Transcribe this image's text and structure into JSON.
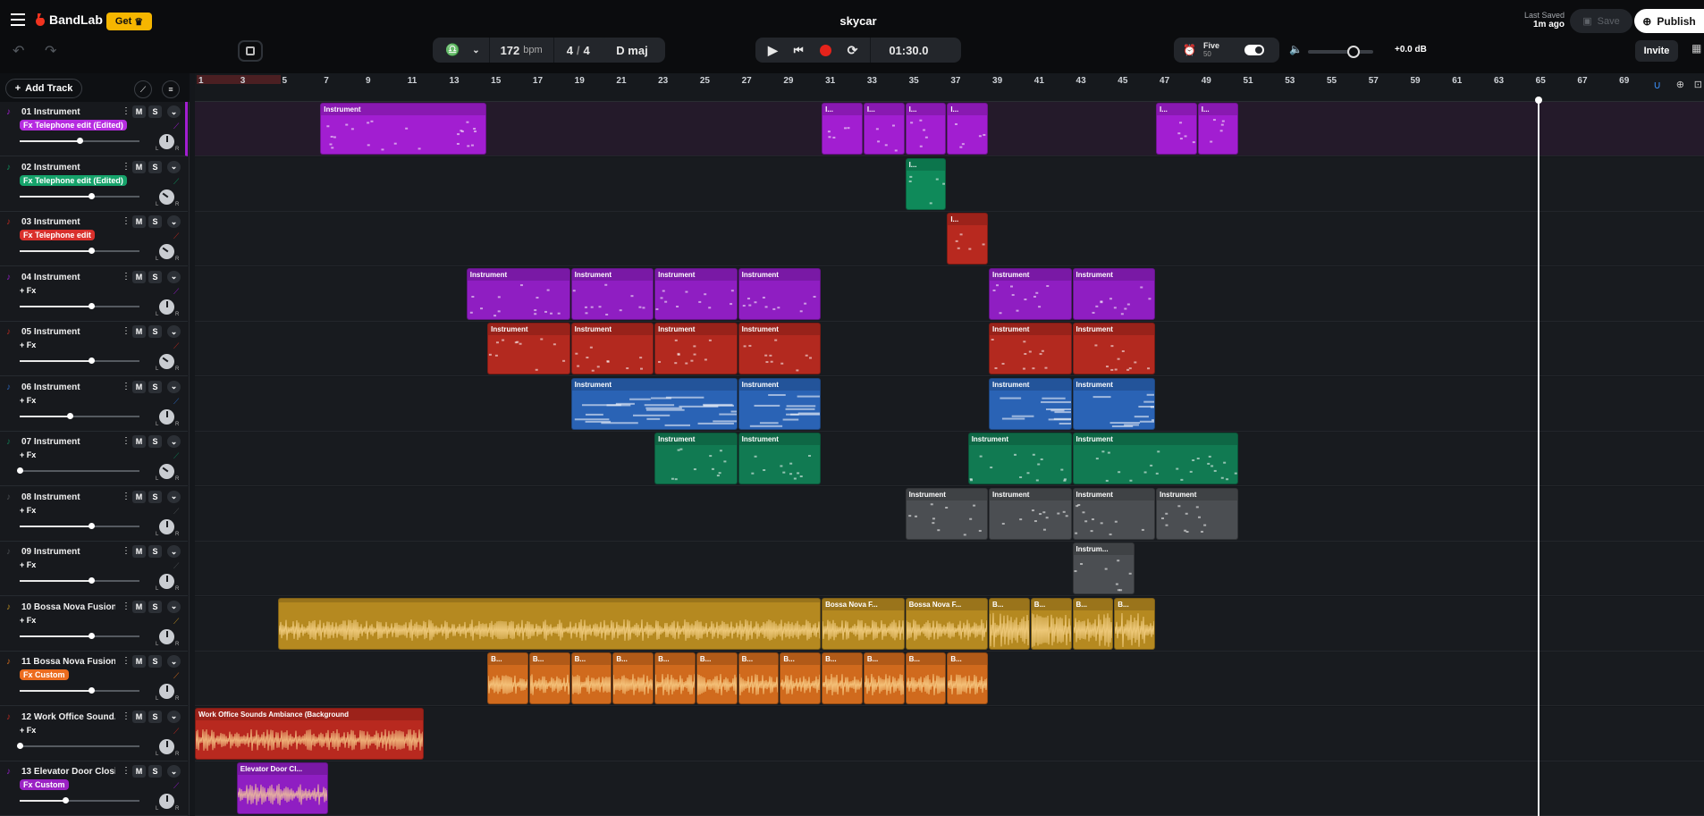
{
  "app": {
    "brand": "BandLab",
    "get_label": "Get",
    "project": "skycar",
    "last_saved_label": "Last Saved",
    "last_saved_time": "1m ago",
    "save_label": "Save",
    "publish_label": "Publish",
    "invite_label": "Invite"
  },
  "transport": {
    "bpm": "172",
    "bpm_unit": "bpm",
    "sig_num": "4",
    "sig_den": "4",
    "key": "D maj",
    "time": "01:30.0",
    "metronome_name": "Five",
    "metronome_count": "50",
    "master_db": "+0.0 dB"
  },
  "header": {
    "add_track": "Add Track"
  },
  "ruler": [
    "1",
    "3",
    "5",
    "7",
    "9",
    "11",
    "13",
    "15",
    "17",
    "19",
    "21",
    "23",
    "25",
    "27",
    "29",
    "31",
    "33",
    "35",
    "37",
    "39",
    "41",
    "43",
    "45",
    "47",
    "49",
    "51",
    "53",
    "55",
    "57",
    "59",
    "61",
    "63",
    "65",
    "67",
    "69"
  ],
  "common": {
    "mute": "M",
    "solo": "S",
    "fx_add": "+ Fx",
    "pan_l": "L",
    "pan_r": "R"
  },
  "tracks": [
    {
      "num": "01",
      "name": "Instrument",
      "fx": "Fx Telephone edit (Edited)",
      "fx_color": "#b62ce0",
      "color": "#a21ed1",
      "vol": 0.5,
      "pan": 0.5
    },
    {
      "num": "02",
      "name": "Instrument",
      "fx": "Fx Telephone edit (Edited)",
      "fx_color": "#16a36b",
      "color": "#0f8a5a",
      "vol": 0.6,
      "pan": 0.3
    },
    {
      "num": "03",
      "name": "Instrument",
      "fx": "Fx Telephone edit",
      "fx_color": "#d9302c",
      "color": "#b8291f",
      "vol": 0.6,
      "pan": 0.3
    },
    {
      "num": "04",
      "name": "Instrument",
      "fx": "+ Fx",
      "fx_color": "",
      "color": "#8f1ec2",
      "vol": 0.6,
      "pan": 0.5
    },
    {
      "num": "05",
      "name": "Instrument",
      "fx": "+ Fx",
      "fx_color": "",
      "color": "#b3291f",
      "vol": 0.6,
      "pan": 0.3
    },
    {
      "num": "06",
      "name": "Instrument",
      "fx": "+ Fx",
      "fx_color": "",
      "color": "#2a63b5",
      "vol": 0.42,
      "pan": 0.5
    },
    {
      "num": "07",
      "name": "Instrument",
      "fx": "+ Fx",
      "fx_color": "",
      "color": "#117a52",
      "vol": 0.0,
      "pan": 0.3
    },
    {
      "num": "08",
      "name": "Instrument",
      "fx": "+ Fx",
      "fx_color": "",
      "color": "#4b4e52",
      "vol": 0.6,
      "pan": 0.5
    },
    {
      "num": "09",
      "name": "Instrument",
      "fx": "+ Fx",
      "fx_color": "",
      "color": "#4b4e52",
      "vol": 0.6,
      "pan": 0.5
    },
    {
      "num": "10",
      "name": "Bossa Nova Fusion...",
      "fx": "+ Fx",
      "fx_color": "",
      "color": "#b58920",
      "vol": 0.6,
      "pan": 0.5
    },
    {
      "num": "11",
      "name": "Bossa Nova Fusion...",
      "fx": "Fx Custom",
      "fx_color": "#ec6c1e",
      "color": "#d06a1d",
      "vol": 0.6,
      "pan": 0.5
    },
    {
      "num": "12",
      "name": "Work Office Sound...",
      "fx": "+ Fx",
      "fx_color": "",
      "color": "#b8291f",
      "vol": 0.0,
      "pan": 0.5
    },
    {
      "num": "13",
      "name": "Elevator Door Closi...",
      "fx": "Fx Custom",
      "fx_color": "#9b22c4",
      "color": "#8f1ec2",
      "vol": 0.38,
      "pan": 0.5
    }
  ],
  "clips": [
    {
      "track": 0,
      "start": 7,
      "end": 15,
      "label": "Instrument",
      "kind": "midi"
    },
    {
      "track": 0,
      "start": 31,
      "end": 33,
      "label": "I...",
      "kind": "midi"
    },
    {
      "track": 0,
      "start": 33,
      "end": 35,
      "label": "I...",
      "kind": "midi"
    },
    {
      "track": 0,
      "start": 35,
      "end": 37,
      "label": "I...",
      "kind": "midi"
    },
    {
      "track": 0,
      "start": 37,
      "end": 39,
      "label": "I...",
      "kind": "midi"
    },
    {
      "track": 0,
      "start": 47,
      "end": 49,
      "label": "I...",
      "kind": "midi"
    },
    {
      "track": 0,
      "start": 49,
      "end": 51,
      "label": "I...",
      "kind": "midi"
    },
    {
      "track": 1,
      "start": 35,
      "end": 37,
      "label": "I...",
      "kind": "midi"
    },
    {
      "track": 2,
      "start": 37,
      "end": 39,
      "label": "I...",
      "kind": "midi"
    },
    {
      "track": 3,
      "start": 14,
      "end": 19,
      "label": "Instrument",
      "kind": "midi"
    },
    {
      "track": 3,
      "start": 19,
      "end": 23,
      "label": "Instrument",
      "kind": "midi"
    },
    {
      "track": 3,
      "start": 23,
      "end": 27,
      "label": "Instrument",
      "kind": "midi"
    },
    {
      "track": 3,
      "start": 27,
      "end": 31,
      "label": "Instrument",
      "kind": "midi"
    },
    {
      "track": 3,
      "start": 39,
      "end": 43,
      "label": "Instrument",
      "kind": "midi"
    },
    {
      "track": 3,
      "start": 43,
      "end": 47,
      "label": "Instrument",
      "kind": "midi"
    },
    {
      "track": 4,
      "start": 15,
      "end": 19,
      "label": "Instrument",
      "kind": "midi"
    },
    {
      "track": 4,
      "start": 19,
      "end": 23,
      "label": "Instrument",
      "kind": "midi"
    },
    {
      "track": 4,
      "start": 23,
      "end": 27,
      "label": "Instrument",
      "kind": "midi"
    },
    {
      "track": 4,
      "start": 27,
      "end": 31,
      "label": "Instrument",
      "kind": "midi"
    },
    {
      "track": 4,
      "start": 39,
      "end": 43,
      "label": "Instrument",
      "kind": "midi"
    },
    {
      "track": 4,
      "start": 43,
      "end": 47,
      "label": "Instrument",
      "kind": "midi"
    },
    {
      "track": 5,
      "start": 19,
      "end": 27,
      "label": "Instrument",
      "kind": "midi"
    },
    {
      "track": 5,
      "start": 27,
      "end": 31,
      "label": "Instrument",
      "kind": "midi"
    },
    {
      "track": 5,
      "start": 39,
      "end": 43,
      "label": "Instrument",
      "kind": "midi"
    },
    {
      "track": 5,
      "start": 43,
      "end": 47,
      "label": "Instrument",
      "kind": "midi"
    },
    {
      "track": 6,
      "start": 23,
      "end": 27,
      "label": "Instrument",
      "kind": "midi"
    },
    {
      "track": 6,
      "start": 27,
      "end": 31,
      "label": "Instrument",
      "kind": "midi"
    },
    {
      "track": 6,
      "start": 38,
      "end": 43,
      "label": "Instrument",
      "kind": "midi"
    },
    {
      "track": 6,
      "start": 43,
      "end": 51,
      "label": "Instrument",
      "kind": "midi"
    },
    {
      "track": 7,
      "start": 35,
      "end": 39,
      "label": "Instrument",
      "kind": "midi"
    },
    {
      "track": 7,
      "start": 39,
      "end": 43,
      "label": "Instrument",
      "kind": "midi"
    },
    {
      "track": 7,
      "start": 43,
      "end": 47,
      "label": "Instrument",
      "kind": "midi"
    },
    {
      "track": 7,
      "start": 47,
      "end": 51,
      "label": "Instrument",
      "kind": "midi"
    },
    {
      "track": 8,
      "start": 43,
      "end": 46,
      "label": "Instrum...",
      "kind": "midi"
    },
    {
      "track": 9,
      "start": 5,
      "end": 31,
      "label": "",
      "kind": "audio"
    },
    {
      "track": 9,
      "start": 31,
      "end": 35,
      "label": "Bossa Nova F...",
      "kind": "audio"
    },
    {
      "track": 9,
      "start": 35,
      "end": 39,
      "label": "Bossa Nova F...",
      "kind": "audio"
    },
    {
      "track": 9,
      "start": 39,
      "end": 41,
      "label": "B...",
      "kind": "audio"
    },
    {
      "track": 9,
      "start": 41,
      "end": 43,
      "label": "B...",
      "kind": "audio"
    },
    {
      "track": 9,
      "start": 43,
      "end": 45,
      "label": "B...",
      "kind": "audio"
    },
    {
      "track": 9,
      "start": 45,
      "end": 47,
      "label": "B...",
      "kind": "audio"
    },
    {
      "track": 10,
      "start": 15,
      "end": 17,
      "label": "B...",
      "kind": "audio"
    },
    {
      "track": 10,
      "start": 17,
      "end": 19,
      "label": "B...",
      "kind": "audio"
    },
    {
      "track": 10,
      "start": 19,
      "end": 21,
      "label": "B...",
      "kind": "audio"
    },
    {
      "track": 10,
      "start": 21,
      "end": 23,
      "label": "B...",
      "kind": "audio"
    },
    {
      "track": 10,
      "start": 23,
      "end": 25,
      "label": "B...",
      "kind": "audio"
    },
    {
      "track": 10,
      "start": 25,
      "end": 27,
      "label": "B...",
      "kind": "audio"
    },
    {
      "track": 10,
      "start": 27,
      "end": 29,
      "label": "B...",
      "kind": "audio"
    },
    {
      "track": 10,
      "start": 29,
      "end": 31,
      "label": "B...",
      "kind": "audio"
    },
    {
      "track": 10,
      "start": 31,
      "end": 33,
      "label": "B...",
      "kind": "audio"
    },
    {
      "track": 10,
      "start": 33,
      "end": 35,
      "label": "B...",
      "kind": "audio"
    },
    {
      "track": 10,
      "start": 35,
      "end": 37,
      "label": "B...",
      "kind": "audio"
    },
    {
      "track": 10,
      "start": 37,
      "end": 39,
      "label": "B...",
      "kind": "audio"
    },
    {
      "track": 11,
      "start": 1,
      "end": 12,
      "label": "Work Office Sounds Ambiance (Background",
      "kind": "audio"
    },
    {
      "track": 12,
      "start": 3,
      "end": 7.4,
      "label": "Elevator Door Cl...",
      "kind": "audio"
    }
  ]
}
